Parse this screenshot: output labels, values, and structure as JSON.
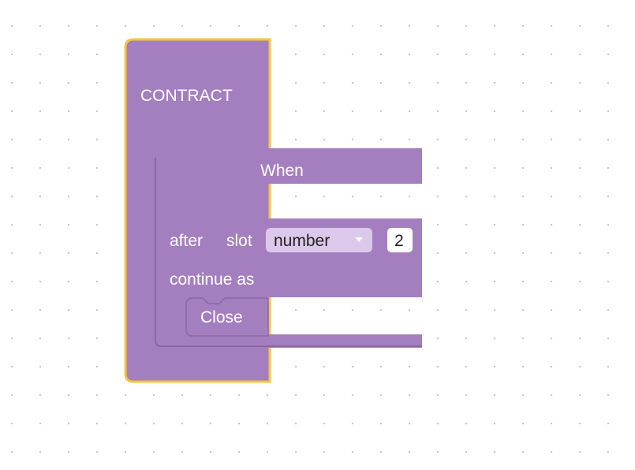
{
  "workspace": {
    "grid": "dotted",
    "background": "#ffffff"
  },
  "colors": {
    "block_fill": "#a47fc0",
    "block_dark": "#8a68a6",
    "selection_outline": "#f8c43a",
    "dropdown_fill": "#dcc8ea",
    "number_field_fill": "#ffffff"
  },
  "contract_block": {
    "label": "CONTRACT",
    "selected": true
  },
  "when_block": {
    "label": "When",
    "after_label": "after",
    "slot_label": "slot",
    "slot_dropdown_value": "number",
    "dropdown_icon": "triangle-down-icon",
    "timeout_value": "2",
    "continue_label": "continue as"
  },
  "close_block": {
    "label": "Close"
  }
}
